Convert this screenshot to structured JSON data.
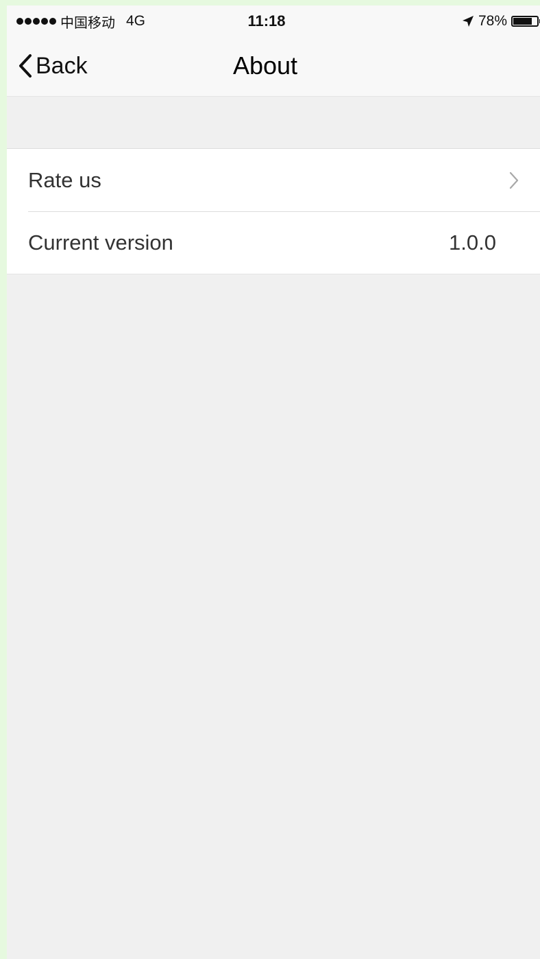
{
  "status_bar": {
    "carrier": "中国移动",
    "network": "4G",
    "time": "11:18",
    "battery_percent": "78%",
    "battery_level": 0.78
  },
  "nav": {
    "back_label": "Back",
    "title": "About"
  },
  "list": {
    "items": [
      {
        "label": "Rate us",
        "icon": "chevron-right-icon"
      },
      {
        "label": "Current version",
        "value": "1.0.0"
      }
    ]
  },
  "colors": {
    "background": "#f0f0f0",
    "bar": "#f8f8f8",
    "row": "#ffffff",
    "text": "#333333"
  }
}
